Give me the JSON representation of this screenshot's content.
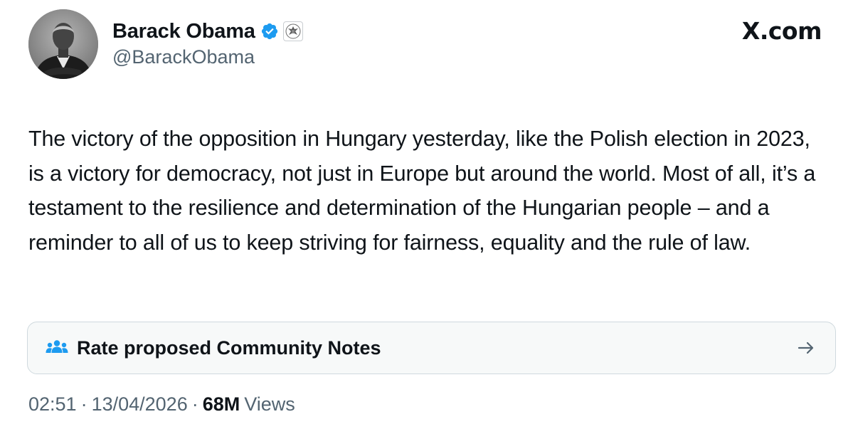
{
  "author": {
    "display_name": "Barack Obama",
    "handle": "@BarackObama",
    "verified_badge_icon": "verified-badge-icon",
    "affiliation_icon": "us-seal-icon",
    "avatar": "profile-photo"
  },
  "brand": {
    "label": "X.com"
  },
  "tweet": {
    "text": "The victory of the opposition in Hungary yesterday, like the Polish election in 2023, is a victory for democracy, not just in Europe but around the world. Most of all, it’s a testament to the resilience and determination of the Hungarian people – and a reminder to all of us to keep striving for fairness, equality and the rule of law."
  },
  "community_notes": {
    "label": "Rate proposed Community Notes",
    "icon": "people-icon",
    "arrow_icon": "arrow-right-icon"
  },
  "meta": {
    "time": "02:51",
    "separator": "·",
    "date": "13/04/2026",
    "views_count": "68M",
    "views_label": "Views"
  },
  "colors": {
    "text": "#0f1419",
    "secondary_text": "#536471",
    "verified_blue": "#1d9bf0",
    "card_background": "#f7f9f9",
    "card_border": "#cfd9de"
  }
}
